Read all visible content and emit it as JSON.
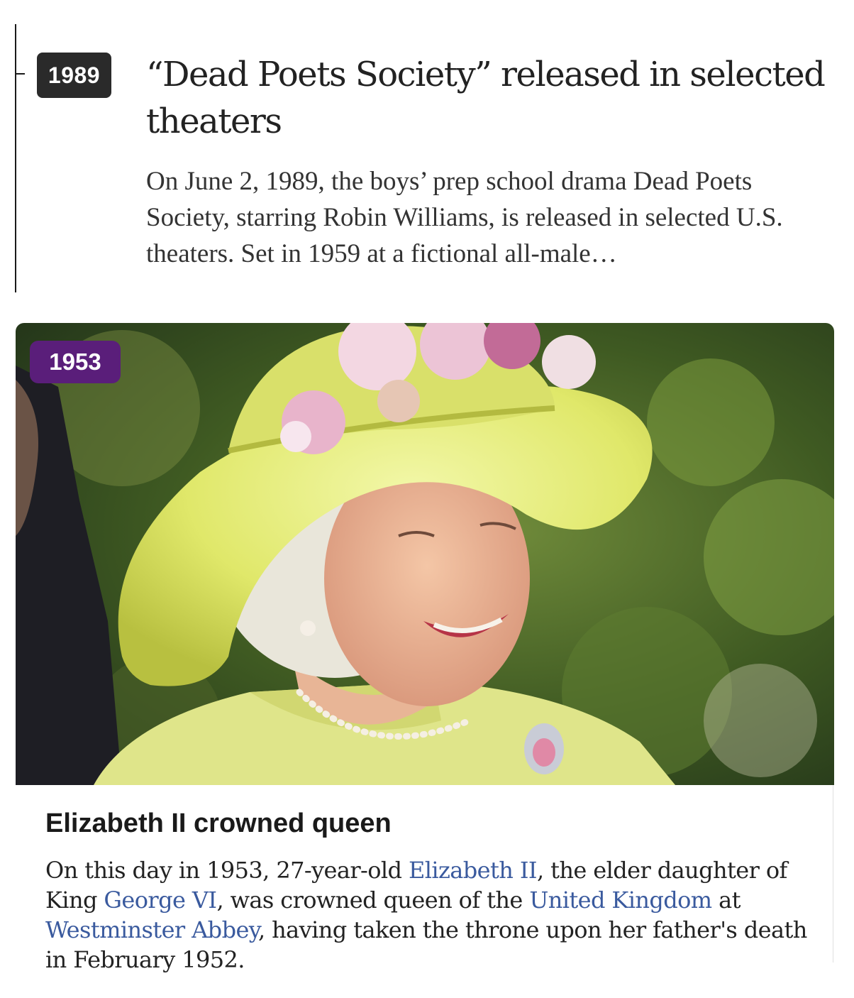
{
  "entry1": {
    "year": "1989",
    "title": "“Dead Poets Society” released in selected theaters",
    "summary": "On June 2, 1989, the boys’ prep school drama Dead Poets Society, starring Robin Williams, is released in selected U.S. theaters. Set in 1959 at a fictional all-male…"
  },
  "entry2": {
    "year": "1953",
    "badge_color": "#5a1e7a",
    "title": "Elizabeth II crowned queen",
    "text": {
      "t1": "On this day in 1953, 27-year-old ",
      "link1": "Elizabeth II",
      "t2": ", the elder daughter of King ",
      "link2": "George VI",
      "t3": ", was crowned queen of the ",
      "link3": "United Kingdom",
      "t4": " at ",
      "link4": "Westminster Abbey",
      "t5": ", having taken the throne upon her father's death in February 1952."
    },
    "link_color": "#3a5a9e"
  }
}
